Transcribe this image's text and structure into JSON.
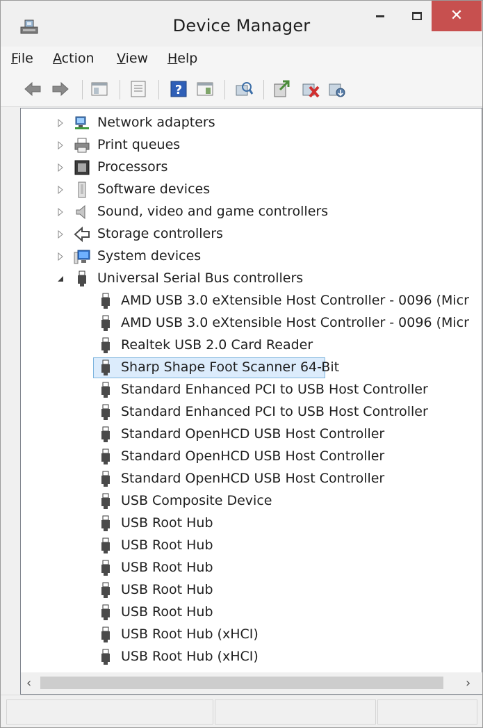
{
  "window": {
    "title": "Device Manager",
    "close_glyph": "✕"
  },
  "menu": {
    "items": [
      {
        "label": "File"
      },
      {
        "label": "Action"
      },
      {
        "label": "View"
      },
      {
        "label": "Help"
      }
    ]
  },
  "toolbar": {
    "buttons": [
      {
        "icon": "back-arrow-icon"
      },
      {
        "icon": "forward-arrow-icon"
      },
      {
        "icon": "show-hide-console-tree-icon"
      },
      {
        "icon": "properties-icon"
      },
      {
        "icon": "help-icon"
      },
      {
        "icon": "show-action-pane-icon"
      },
      {
        "icon": "scan-hardware-changes-icon"
      },
      {
        "icon": "update-driver-icon"
      },
      {
        "icon": "uninstall-device-icon"
      },
      {
        "icon": "disable-device-icon"
      }
    ]
  },
  "tree": {
    "categories": [
      {
        "label": "Network adapters",
        "icon": "network-adapter-icon",
        "expanded": false
      },
      {
        "label": "Print queues",
        "icon": "printer-icon",
        "expanded": false
      },
      {
        "label": "Processors",
        "icon": "processor-icon",
        "expanded": false
      },
      {
        "label": "Software devices",
        "icon": "software-device-icon",
        "expanded": false
      },
      {
        "label": "Sound, video and game controllers",
        "icon": "speaker-icon",
        "expanded": false
      },
      {
        "label": "Storage controllers",
        "icon": "storage-controller-icon",
        "expanded": false
      },
      {
        "label": "System devices",
        "icon": "system-devices-icon",
        "expanded": false
      },
      {
        "label": "Universal Serial Bus controllers",
        "icon": "usb-plug-icon",
        "expanded": true
      }
    ],
    "usb_children": [
      {
        "label": "AMD USB 3.0 eXtensible Host Controller - 0096 (Micr"
      },
      {
        "label": "AMD USB 3.0 eXtensible Host Controller - 0096 (Micr"
      },
      {
        "label": "Realtek USB 2.0 Card Reader"
      },
      {
        "label": "Sharp Shape Foot Scanner 64-Bit",
        "selected": true
      },
      {
        "label": "Standard Enhanced PCI to USB Host Controller"
      },
      {
        "label": "Standard Enhanced PCI to USB Host Controller"
      },
      {
        "label": "Standard OpenHCD USB Host Controller"
      },
      {
        "label": "Standard OpenHCD USB Host Controller"
      },
      {
        "label": "Standard OpenHCD USB Host Controller"
      },
      {
        "label": "USB Composite Device"
      },
      {
        "label": "USB Root Hub"
      },
      {
        "label": "USB Root Hub"
      },
      {
        "label": "USB Root Hub"
      },
      {
        "label": "USB Root Hub"
      },
      {
        "label": "USB Root Hub"
      },
      {
        "label": "USB Root Hub (xHCI)"
      },
      {
        "label": "USB Root Hub (xHCI)"
      }
    ]
  },
  "colors": {
    "accent_close": "#c7504f",
    "selection_bg": "#dcecfc",
    "selection_border": "#7cb4de"
  }
}
